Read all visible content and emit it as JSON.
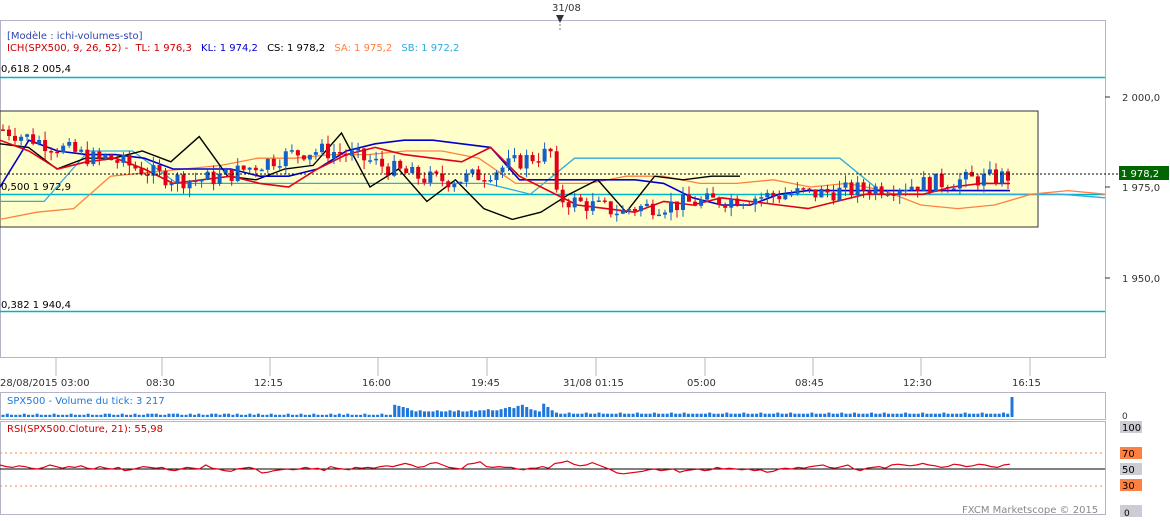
{
  "date_marker": "31/08",
  "model_label": "[Modèle : ichi-volumes-sto]",
  "ichimoku": {
    "name": "ICH(SPX500, 9, 26, 52) -",
    "tl": "TL: 1 976,3",
    "kl": "KL: 1 974,2",
    "cs": "CS: 1 978,2",
    "sa": "SA: 1 975,2",
    "sb": "SB: 1 972,2"
  },
  "fib_levels": [
    {
      "label": "0,618 2 005,4",
      "value": 2005.4
    },
    {
      "label": "0,500 1 972,9",
      "value": 1972.9
    },
    {
      "label": "0,382 1 940,4",
      "value": 1940.4
    }
  ],
  "price_axis": {
    "ticks": [
      {
        "label": "2 000,0",
        "value": 2000.0
      },
      {
        "label": "1 975,0",
        "value": 1975.0
      },
      {
        "label": "1 950,0",
        "value": 1950.0
      }
    ],
    "current_price_label": "1 978,2"
  },
  "time_axis": [
    "28/08/2015 03:00",
    "08:30",
    "12:15",
    "16:00",
    "19:45",
    "31/08 01:15",
    "05:00",
    "08:45",
    "12:30",
    "16:15"
  ],
  "volume_panel": {
    "title": "SPX500 - Volume du tick: 3 217",
    "axis_label": "0"
  },
  "rsi_panel": {
    "title": "RSI(SPX500.Cloture, 21): 55,98",
    "levels": [
      {
        "label": "100",
        "value": 100
      },
      {
        "label": "70",
        "value": 70
      },
      {
        "label": "50",
        "value": 50
      },
      {
        "label": "30",
        "value": 30
      },
      {
        "label": "0",
        "value": 0
      }
    ]
  },
  "footer": "FXCM Marketscope © 2015",
  "colors": {
    "tenkan": "#e0001a",
    "kijun": "#0000cc",
    "chikou": "#000000",
    "senkou_a": "#ff8040",
    "senkou_b": "#33aadd",
    "fib": "#00b4c8",
    "box_fill": "#ffffcc",
    "candle_up": "#1560c8",
    "candle_down": "#e0001a",
    "volume": "#1e78dc",
    "rsi": "#e0001a",
    "current_price_bg": "#006600"
  },
  "chart_data": {
    "type": "candlestick",
    "price_range": [
      1928,
      2016
    ],
    "candles_summary": {
      "start": 1992,
      "end": 1978.2,
      "low": 1962,
      "high": 1993
    },
    "tenkan": [
      1988,
      1985,
      1980,
      1982,
      1983,
      1980,
      1976,
      1977,
      1978,
      1976,
      1975,
      1980,
      1984,
      1986,
      1984,
      1983,
      1982,
      1986,
      1978,
      1974,
      1970,
      1969,
      1968,
      1971,
      1970,
      1972,
      1971,
      1970,
      1969,
      1971,
      1973,
      1973,
      1973,
      1975,
      1976,
      1976
    ],
    "kijun": [
      1975,
      1988,
      1985,
      1984,
      1984,
      1983,
      1980,
      1980,
      1980,
      1978,
      1978,
      1980,
      1985,
      1987,
      1988,
      1988,
      1987,
      1986,
      1977,
      1977,
      1977,
      1977,
      1977,
      1976,
      1972,
      1970,
      1970,
      1973,
      1974,
      1974,
      1974,
      1974,
      1974,
      1974,
      1974,
      1974
    ],
    "chikou": [
      1987,
      1986,
      1980,
      1983,
      1983,
      1985,
      1982,
      1989,
      1978,
      1977,
      1980,
      1981,
      1990,
      1975,
      1980,
      1971,
      1977,
      1969,
      1966,
      1968,
      1973,
      1977,
      1968,
      1978,
      1977,
      1978,
      1978
    ],
    "senkou_a": [
      1966,
      1968,
      1969,
      1978,
      1979,
      1980,
      1981,
      1983,
      1983,
      1984,
      1984,
      1985,
      1985,
      1983,
      1976,
      1976,
      1976,
      1978,
      1978,
      1976,
      1976,
      1977,
      1975,
      1976,
      1974,
      1970,
      1969,
      1970,
      1973,
      1974,
      1973
    ],
    "senkou_b": [
      1971,
      1971,
      1985,
      1985,
      1976,
      1976,
      1976,
      1976,
      1976,
      1976,
      1976,
      1976,
      1973,
      1983,
      1983,
      1983,
      1983,
      1983,
      1983,
      1983,
      1973,
      1973,
      1973,
      1973,
      1973,
      1972
    ],
    "volume": [
      2,
      3,
      2,
      2,
      2,
      3,
      2,
      2,
      3,
      2,
      2,
      2,
      3,
      2,
      2,
      2,
      3,
      2,
      2,
      2,
      3,
      2,
      2,
      2,
      3,
      3,
      2,
      2,
      3,
      2,
      2,
      3,
      2,
      2,
      3,
      3,
      3,
      2,
      2,
      3,
      3,
      3,
      2,
      2,
      3,
      2,
      3,
      2,
      2,
      3,
      3,
      2,
      3,
      3,
      2,
      3,
      2,
      2,
      3,
      2,
      3,
      2,
      2,
      3,
      2,
      2,
      2,
      3,
      2,
      2,
      3,
      2,
      2,
      3,
      2,
      2,
      2,
      3,
      2,
      3,
      2,
      3,
      2,
      2,
      2,
      3,
      2,
      2,
      2,
      3,
      2,
      2,
      11,
      10,
      9,
      8,
      6,
      5,
      6,
      5,
      5,
      5,
      6,
      5,
      5,
      6,
      5,
      6,
      5,
      5,
      6,
      5,
      6,
      6,
      7,
      6,
      6,
      7,
      8,
      9,
      8,
      10,
      11,
      9,
      7,
      6,
      5,
      12,
      9,
      6,
      4,
      3,
      3,
      4,
      3,
      3,
      3,
      4,
      3,
      3,
      4,
      3,
      3,
      3,
      3,
      4,
      3,
      3,
      3,
      4,
      3,
      3,
      3,
      4,
      3,
      3,
      3,
      4,
      3,
      3,
      4,
      3,
      3,
      3,
      3,
      3,
      4,
      3,
      3,
      3,
      4,
      3,
      3,
      3,
      4,
      3,
      3,
      3,
      4,
      3,
      3,
      3,
      4,
      3,
      3,
      4,
      3,
      3,
      3,
      3,
      4,
      3,
      3,
      3,
      4,
      3,
      3,
      4,
      3,
      3,
      4,
      3,
      3,
      3,
      4,
      3,
      3,
      4,
      3,
      3,
      3,
      3,
      4,
      3,
      3,
      3,
      4,
      3,
      3,
      3,
      3,
      4,
      3,
      3,
      3,
      3,
      4,
      3,
      3,
      3,
      4,
      3,
      3,
      3,
      3,
      4,
      3,
      18
    ],
    "rsi": [
      55,
      53,
      52,
      54,
      53,
      51,
      50,
      52,
      55,
      53,
      51,
      53,
      52,
      54,
      51,
      50,
      53,
      51,
      50,
      52,
      48,
      49,
      51,
      53,
      52,
      51,
      52,
      49,
      48,
      50,
      52,
      51,
      50,
      55,
      51,
      50,
      48,
      47,
      50,
      51,
      52,
      50,
      45,
      46,
      48,
      49,
      50,
      49,
      50,
      52,
      50,
      51,
      48,
      53,
      51,
      50,
      49,
      52,
      51,
      52,
      51,
      53,
      54,
      53,
      55,
      57,
      55,
      52,
      53,
      57,
      58,
      55,
      52,
      51,
      50,
      56,
      57,
      59,
      53,
      52,
      53,
      52,
      52,
      50,
      49,
      51,
      51,
      53,
      51,
      57,
      58,
      60,
      56,
      54,
      55,
      58,
      55,
      52,
      49,
      45,
      44,
      45,
      46,
      47,
      49,
      50,
      48,
      49,
      50,
      46,
      48,
      49,
      50,
      48,
      49,
      52,
      50,
      51,
      50,
      49,
      50,
      48,
      49,
      46,
      47,
      50,
      51,
      50,
      52,
      51,
      53,
      54,
      55,
      52,
      51,
      53,
      55,
      50,
      48,
      51,
      52,
      53,
      51,
      55,
      56,
      55,
      54,
      55,
      57,
      55,
      54,
      52,
      53,
      56,
      55,
      53,
      54,
      56,
      55,
      53,
      52,
      55,
      56
    ],
    "rsi_range": [
      0,
      100
    ]
  }
}
